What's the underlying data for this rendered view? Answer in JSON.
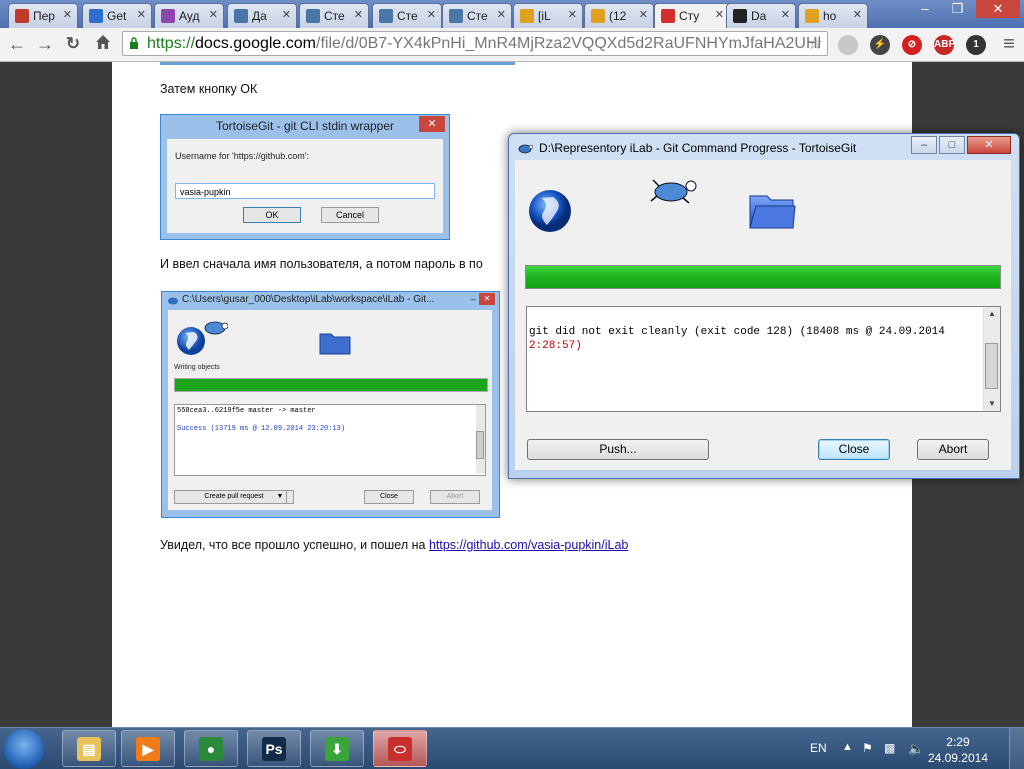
{
  "browser": {
    "tabs": [
      {
        "label": "Пер",
        "icon": "flag-icon",
        "color": "#c0392b"
      },
      {
        "label": "Get",
        "icon": "pf-icon",
        "color": "#2d6fcf"
      },
      {
        "label": "Ауд",
        "icon": "pause-icon",
        "color": "#8e44ad"
      },
      {
        "label": "Да",
        "icon": "vk-icon",
        "color": "#4a76a8"
      },
      {
        "label": "Сте",
        "icon": "vk-icon",
        "color": "#4a76a8"
      },
      {
        "label": "Сте",
        "icon": "vk-icon",
        "color": "#4a76a8"
      },
      {
        "label": "Сте",
        "icon": "vk-icon",
        "color": "#4a76a8"
      },
      {
        "label": "[iL",
        "icon": "ilab-icon",
        "color": "#e0a020"
      },
      {
        "label": "(12",
        "icon": "ilab-icon",
        "color": "#e0a020"
      },
      {
        "label": "Сту",
        "icon": "pdf-icon",
        "color": "#d32f2f"
      },
      {
        "label": "Da",
        "icon": "github-icon",
        "color": "#222222"
      },
      {
        "label": "ho",
        "icon": "ilab-icon",
        "color": "#e0a020"
      }
    ],
    "url_scheme": "https://",
    "url_host": "docs.google.com",
    "url_path": "/file/d/0B7-YX4kPnHi_MnR4MjRza2VQQXd5d2RaUFNHYmJfaHA2UHl",
    "extensions": [
      {
        "name": "opera-icon",
        "text": "",
        "color": "#c8c8c8"
      },
      {
        "name": "bolt-icon",
        "text": "⚡",
        "color": "#444444"
      },
      {
        "name": "adblock-stop-icon",
        "text": "⊘",
        "color": "#d42020"
      },
      {
        "name": "abp-icon",
        "text": "ABP",
        "color": "#c62828"
      },
      {
        "name": "glasses-icon",
        "text": "1",
        "color": "#333333"
      }
    ]
  },
  "document": {
    "line1": "Затем кнопку ОК",
    "line2": "И ввел сначала имя пользователя, а потом пароль в по",
    "line3_text": "Увидел, что все прошло успешно, и пошел на ",
    "line3_link": "https://github.com/vasia-pupkin/iLab"
  },
  "embedded_login": {
    "title": "TortoiseGit -  git CLI stdin wrapper",
    "label": "Username for 'https://github.com':",
    "value": "vasia-pupkin",
    "ok": "OK",
    "cancel": "Cancel"
  },
  "embedded_progress": {
    "title": "C:\\Users\\gusar_000\\Desktop\\iLab\\workspace\\iLab - Git...",
    "status": "Writing objects",
    "log_line1": "558cea3..6219f5e  master -> master",
    "log_line2": "Success (13719 ms @ 12.09.2014 23:20:13)",
    "pull_request": "Create pull request",
    "close": "Close",
    "abort": "Abort",
    "progress": 1.0
  },
  "dialog": {
    "title": "D:\\Representory iLab - Git Command Progress - TortoiseGit",
    "log_part1": "git did not exit cleanly (exit code 128) (18408 ms @ 24.09.2014",
    "log_part2": "2:28:57)",
    "push": "Push...",
    "close": "Close",
    "abort": "Abort",
    "progress": 1.0
  },
  "taskbar": {
    "apps": [
      {
        "name": "explorer-icon",
        "active": false
      },
      {
        "name": "media-player-icon",
        "active": false
      },
      {
        "name": "chrome-icon",
        "active": false
      },
      {
        "name": "photoshop-icon",
        "active": false
      },
      {
        "name": "download-icon",
        "active": false
      },
      {
        "name": "tortoisegit-icon",
        "active": true
      }
    ],
    "lang": "EN",
    "time": "2:29",
    "date": "24.09.2014"
  },
  "colors": {
    "progress_green": "#1fb21f",
    "error_red": "#c00000",
    "link": "#1a0dab"
  }
}
